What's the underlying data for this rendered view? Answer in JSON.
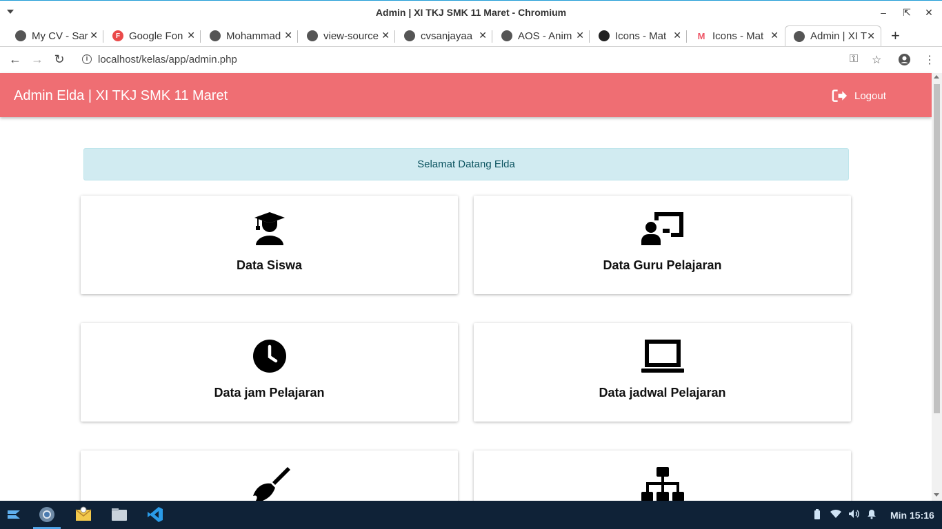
{
  "window": {
    "title": "Admin | XI TKJ SMK 11 Maret - Chromium"
  },
  "tabs": [
    {
      "label": "My CV - Sar",
      "favicon": "globe-icon"
    },
    {
      "label": "Google Fon",
      "favicon": "google-fonts-icon"
    },
    {
      "label": "Mohammad",
      "favicon": "globe-icon"
    },
    {
      "label": "view-source",
      "favicon": "globe-icon"
    },
    {
      "label": "cvsanjayaa",
      "favicon": "globe-icon"
    },
    {
      "label": "AOS - Anim",
      "favicon": "globe-icon"
    },
    {
      "label": "Icons - Mat",
      "favicon": "materialize-icon"
    },
    {
      "label": "Icons - Mat",
      "favicon": "materialize-red-icon"
    },
    {
      "label": "Admin | XI T",
      "favicon": "globe-icon",
      "active": true
    }
  ],
  "address_bar": {
    "url": "localhost/kelas/app/admin.php"
  },
  "header": {
    "brand": "Admin Elda | XI TKJ SMK 11 Maret",
    "logout_label": "Logout",
    "background": "#ef6e73"
  },
  "alert": {
    "text": "Selamat Datang Elda"
  },
  "cards": [
    {
      "title": "Data Siswa",
      "icon": "student-graduate-icon"
    },
    {
      "title": "Data Guru Pelajaran",
      "icon": "teacher-presentation-icon"
    },
    {
      "title": "Data jam Pelajaran",
      "icon": "clock-icon"
    },
    {
      "title": "Data jadwal Pelajaran",
      "icon": "laptop-icon"
    },
    {
      "title": "",
      "icon": "broom-icon"
    },
    {
      "title": "",
      "icon": "sitemap-icon"
    }
  ],
  "taskbar": {
    "clock": "Min 15:16"
  }
}
